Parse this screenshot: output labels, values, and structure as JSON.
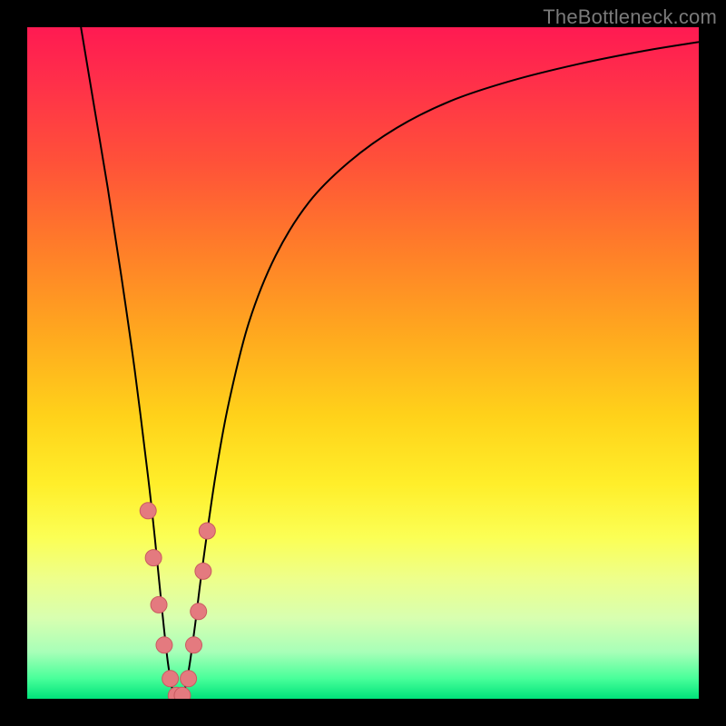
{
  "watermark": "TheBottleneck.com",
  "chart_data": {
    "type": "line",
    "title": "",
    "xlabel": "",
    "ylabel": "",
    "xlim": [
      0,
      100
    ],
    "ylim": [
      0,
      100
    ],
    "series": [
      {
        "name": "curve",
        "x": [
          8,
          10,
          12,
          14,
          16,
          18,
          19,
          20,
          21,
          22,
          23,
          24,
          25,
          26,
          28,
          30,
          33,
          37,
          42,
          48,
          55,
          63,
          72,
          82,
          92,
          100
        ],
        "y": [
          100,
          88,
          76,
          63,
          49,
          33,
          24,
          14,
          5,
          0,
          0,
          4,
          11,
          19,
          33,
          44,
          56,
          66,
          74,
          80,
          85,
          89,
          92,
          94.5,
          96.5,
          97.8
        ]
      }
    ],
    "markers": {
      "name": "dots",
      "x": [
        18.0,
        18.8,
        19.6,
        20.4,
        21.3,
        22.2,
        23.1,
        24.0,
        24.8,
        25.5,
        26.2,
        26.8
      ],
      "y": [
        28,
        21,
        14,
        8,
        3,
        0.5,
        0.5,
        3,
        8,
        13,
        19,
        25
      ]
    },
    "colors": {
      "curve": "#000000",
      "marker_fill": "#e47a7f",
      "marker_stroke": "#c95a60"
    }
  }
}
